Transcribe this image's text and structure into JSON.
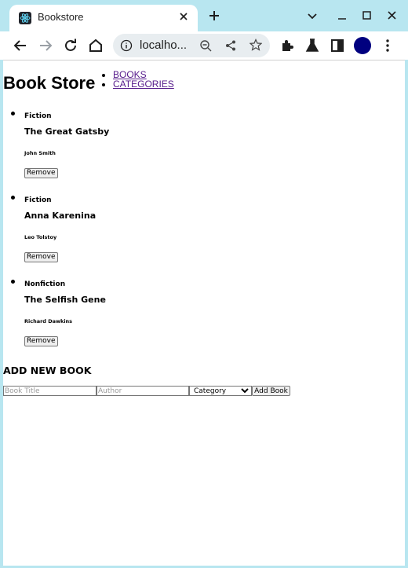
{
  "browser": {
    "tab_title": "Bookstore",
    "address": "localho..."
  },
  "page": {
    "brand": "Book Store",
    "nav": [
      {
        "label": "BOOKS"
      },
      {
        "label": "CATEGORIES"
      }
    ],
    "books": [
      {
        "category": "Fiction",
        "title": "The Great Gatsby",
        "author": "John Smith",
        "remove_label": "Remove"
      },
      {
        "category": "Fiction",
        "title": "Anna Karenina",
        "author": "Leo Tolstoy",
        "remove_label": "Remove"
      },
      {
        "category": "Nonfiction",
        "title": "The Selfish Gene",
        "author": "Richard Dawkins",
        "remove_label": "Remove"
      }
    ],
    "add_book": {
      "heading": "ADD NEW BOOK",
      "title_placeholder": "Book Title",
      "author_placeholder": "Author",
      "category_selected": "Category",
      "submit_label": "Add Book"
    }
  },
  "colors": {
    "frame": "#b8e6f0",
    "link_visited": "#551a8b",
    "avatar": "#00007f"
  },
  "icons": [
    "react-icon",
    "close-icon",
    "plus-icon",
    "chevron-down-icon",
    "minimize-icon",
    "maximize-icon",
    "back-icon",
    "forward-icon",
    "reload-icon",
    "home-icon",
    "info-icon",
    "zoom-out-icon",
    "share-icon",
    "star-icon",
    "extensions-icon",
    "flask-icon",
    "side-panel-icon",
    "menu-icon"
  ]
}
